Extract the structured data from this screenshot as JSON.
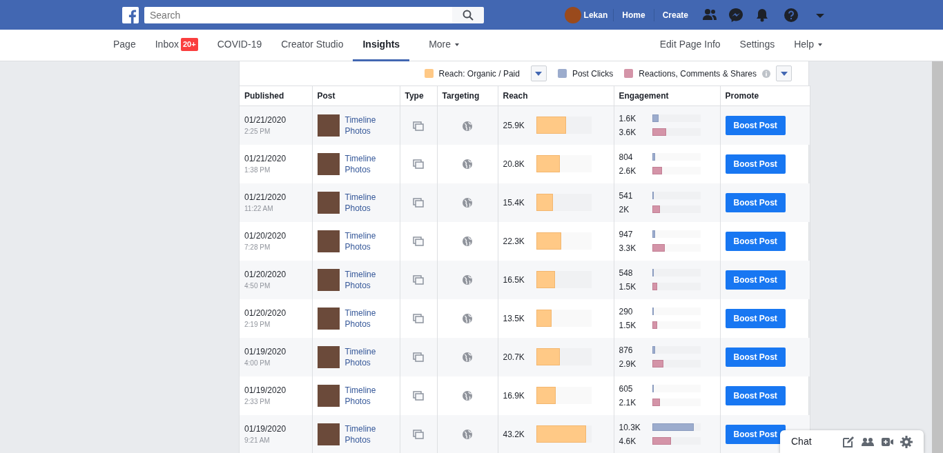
{
  "topbar": {
    "search": {
      "placeholder": "Search"
    },
    "user": "Lekan",
    "links": [
      "Home",
      "Create"
    ]
  },
  "page_nav": {
    "left": [
      {
        "label": "Page",
        "dropdown": false,
        "selected": false
      },
      {
        "label": "Inbox",
        "badge": "20+",
        "dropdown": false,
        "selected": false
      },
      {
        "label": "COVID-19",
        "dropdown": false,
        "selected": false
      },
      {
        "label": "Creator Studio",
        "dropdown": false,
        "selected": false
      },
      {
        "label": "Insights",
        "dropdown": false,
        "selected": true
      },
      {
        "label": "More",
        "dropdown": true,
        "selected": false
      }
    ],
    "right": [
      {
        "label": "Edit Page Info",
        "dropdown": false
      },
      {
        "label": "Settings",
        "dropdown": false
      },
      {
        "label": "Help",
        "dropdown": true
      }
    ]
  },
  "legend": [
    {
      "label": "Reach: Organic / Paid",
      "color": "#ffc986",
      "dropdown": true,
      "info": false
    },
    {
      "label": "Post Clicks",
      "color": "#9caccd",
      "dropdown": false,
      "info": false
    },
    {
      "label": "Reactions, Comments & Shares",
      "color": "#d494a8",
      "dropdown": true,
      "info": true
    }
  ],
  "table": {
    "columns": [
      "Published",
      "Post",
      "Type",
      "Targeting",
      "Reach",
      "Engagement",
      "Promote"
    ],
    "rows": [
      {
        "date": "01/21/2020",
        "time": "2:25 PM",
        "post": "Timeline Photos",
        "reach": "25.9K",
        "reach_bar": {
          "level": 0.54
        },
        "clicks": "1.6K",
        "clicks_bar": {
          "level": 0.13
        },
        "reactions": "3.6K",
        "reactions_bar": {
          "level": 0.29
        },
        "button": "Boost Post"
      },
      {
        "date": "01/21/2020",
        "time": "1:38 PM",
        "post": "Timeline Photos",
        "reach": "20.8K",
        "reach_bar": {
          "level": 0.43
        },
        "clicks": "804",
        "clicks_bar": {
          "level": 0.06
        },
        "reactions": "2.6K",
        "reactions_bar": {
          "level": 0.21
        },
        "button": "Boost Post"
      },
      {
        "date": "01/21/2020",
        "time": "11:22 AM",
        "post": "Timeline Photos",
        "reach": "15.4K",
        "reach_bar": {
          "level": 0.31
        },
        "clicks": "541",
        "clicks_bar": {
          "level": 0.04
        },
        "reactions": "2K",
        "reactions_bar": {
          "level": 0.16
        },
        "button": "Boost Post"
      },
      {
        "date": "01/20/2020",
        "time": "7:28 PM",
        "post": "Timeline Photos",
        "reach": "22.3K",
        "reach_bar": {
          "level": 0.46
        },
        "clicks": "947",
        "clicks_bar": {
          "level": 0.07
        },
        "reactions": "3.3K",
        "reactions_bar": {
          "level": 0.26
        },
        "button": "Boost Post"
      },
      {
        "date": "01/20/2020",
        "time": "4:50 PM",
        "post": "Timeline Photos",
        "reach": "16.5K",
        "reach_bar": {
          "level": 0.34
        },
        "clicks": "548",
        "clicks_bar": {
          "level": 0.04
        },
        "reactions": "1.5K",
        "reactions_bar": {
          "level": 0.11
        },
        "button": "Boost Post"
      },
      {
        "date": "01/20/2020",
        "time": "2:19 PM",
        "post": "Timeline Photos",
        "reach": "13.5K",
        "reach_bar": {
          "level": 0.28
        },
        "clicks": "290",
        "clicks_bar": {
          "level": 0.02
        },
        "reactions": "1.5K",
        "reactions_bar": {
          "level": 0.11
        },
        "button": "Boost Post"
      },
      {
        "date": "01/19/2020",
        "time": "4:00 PM",
        "post": "Timeline Photos",
        "reach": "20.7K",
        "reach_bar": {
          "level": 0.43
        },
        "clicks": "876",
        "clicks_bar": {
          "level": 0.06
        },
        "reactions": "2.9K",
        "reactions_bar": {
          "level": 0.24
        },
        "button": "Boost Post"
      },
      {
        "date": "01/19/2020",
        "time": "2:33 PM",
        "post": "Timeline Photos",
        "reach": "16.9K",
        "reach_bar": {
          "level": 0.35
        },
        "clicks": "605",
        "clicks_bar": {
          "level": 0.04
        },
        "reactions": "2.1K",
        "reactions_bar": {
          "level": 0.17
        },
        "button": "Boost Post"
      },
      {
        "date": "01/19/2020",
        "time": "9:21 AM",
        "post": "Timeline Photos",
        "reach": "43.2K",
        "reach_bar": {
          "level": 0.9
        },
        "clicks": "10.3K",
        "clicks_bar": {
          "level": 0.86
        },
        "reactions": "4.6K",
        "reactions_bar": {
          "level": 0.39
        },
        "button": "Boost Post"
      }
    ]
  },
  "chat": {
    "title": "Chat"
  }
}
